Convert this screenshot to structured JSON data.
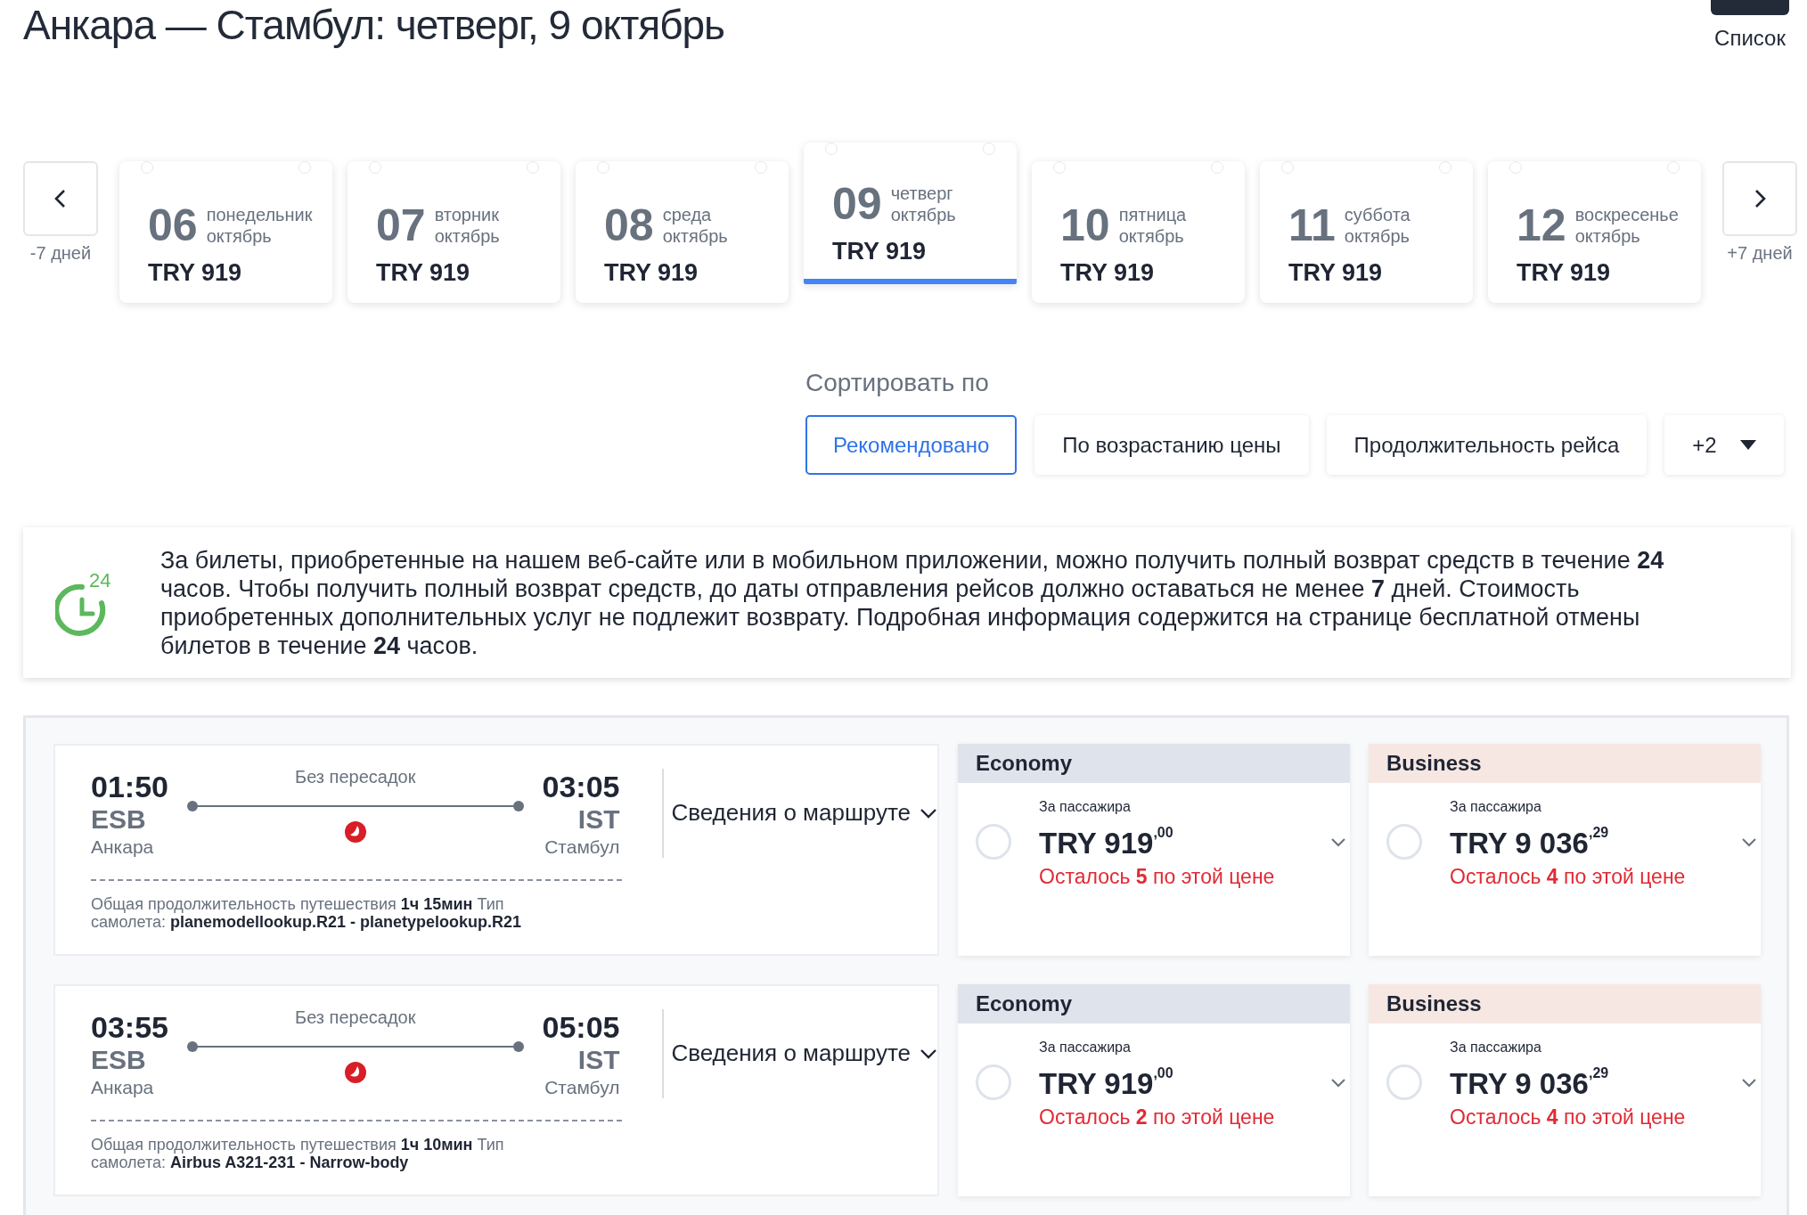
{
  "title": "Анкара — Стамбул: четверг, 9 октябрь",
  "view_toggle": {
    "label": "Список"
  },
  "date_nav": {
    "prev_label": "-7 дней",
    "next_label": "+7 дней"
  },
  "dates": [
    {
      "day": "06",
      "weekday": "понедельник",
      "month": "октябрь",
      "price": "TRY 919",
      "selected": false
    },
    {
      "day": "07",
      "weekday": "вторник",
      "month": "октябрь",
      "price": "TRY 919",
      "selected": false
    },
    {
      "day": "08",
      "weekday": "среда",
      "month": "октябрь",
      "price": "TRY 919",
      "selected": false
    },
    {
      "day": "09",
      "weekday": "четверг",
      "month": "октябрь",
      "price": "TRY 919",
      "selected": true
    },
    {
      "day": "10",
      "weekday": "пятница",
      "month": "октябрь",
      "price": "TRY 919",
      "selected": false
    },
    {
      "day": "11",
      "weekday": "суббота",
      "month": "октябрь",
      "price": "TRY 919",
      "selected": false
    },
    {
      "day": "12",
      "weekday": "воскресенье",
      "month": "октябрь",
      "price": "TRY 919",
      "selected": false
    }
  ],
  "sort": {
    "label": "Сортировать по",
    "options": [
      {
        "label": "Рекомендовано",
        "selected": true
      },
      {
        "label": "По возрастанию цены",
        "selected": false
      },
      {
        "label": "Продолжительность рейса",
        "selected": false
      }
    ],
    "more": "+2"
  },
  "refund_notice": {
    "icon_label": "24",
    "text": "За билеты, приобретенные на нашем веб-сайте или в мобильном приложении, можно получить полный возврат средств в течение **24** часов. Чтобы получить полный возврат средств, до даты отправления рейсов должно оставаться не менее **7** дней. Стоимость приобретенных дополнительных услуг не подлежит возврату. Подробная информация содержится на странице бесплатной отмены билетов в течение **24** часов."
  },
  "flights": [
    {
      "departure_time": "01:50",
      "departure_code": "ESB",
      "departure_city": "Анкара",
      "stops": "Без пересадок",
      "arrival_time": "03:05",
      "arrival_code": "IST",
      "arrival_city": "Стамбул",
      "details_link": "Сведения о маршруте",
      "info": "Общая продолжительность путешествия **1ч 15мин** Тип самолета: **planemodellookup.R21 - planetypelookup.R21**",
      "fares": [
        {
          "kind": "economy",
          "class": "Economy",
          "per_passenger": "За пассажира",
          "price": "TRY 919$^{,00}$",
          "remaining": "Осталось **5** по этой цене",
          "selected": false
        },
        {
          "kind": "business",
          "class": "Business",
          "per_passenger": "За пассажира",
          "price": "TRY 9 036$^{,29}$",
          "remaining": "Осталось **4** по этой цене",
          "selected": false
        }
      ]
    },
    {
      "departure_time": "03:55",
      "departure_code": "ESB",
      "departure_city": "Анкара",
      "stops": "Без пересадок",
      "arrival_time": "05:05",
      "arrival_code": "IST",
      "arrival_city": "Стамбул",
      "details_link": "Сведения о маршруте",
      "info": "Общая продолжительность путешествия **1ч 10мин** Тип самолета: **Airbus A321-231 - Narrow-body**",
      "fares": [
        {
          "kind": "economy",
          "class": "Economy",
          "per_passenger": "За пассажира",
          "price": "TRY 919$^{,00}$",
          "remaining": "Осталось **2** по этой цене",
          "selected": false
        },
        {
          "kind": "business",
          "class": "Business",
          "per_passenger": "За пассажира",
          "price": "TRY 9 036$^{,29}$",
          "remaining": "Осталось **4** по этой цене",
          "selected": false
        }
      ]
    }
  ]
}
